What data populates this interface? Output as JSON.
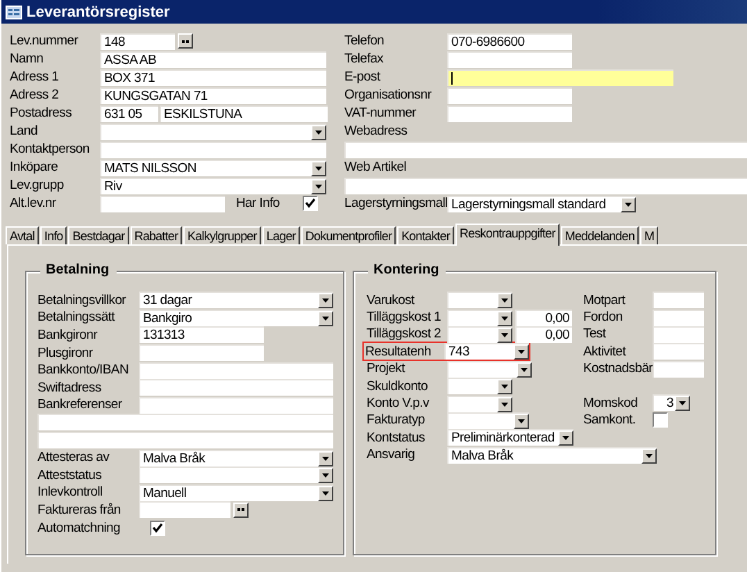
{
  "window": {
    "title": "Leverantörsregister"
  },
  "header_left": [
    {
      "label": "Lev.nummer",
      "fields": [
        {
          "kind": "lookup",
          "value": "148"
        }
      ]
    },
    {
      "label": "Namn",
      "fields": [
        {
          "kind": "text",
          "value": "ASSA AB"
        }
      ]
    },
    {
      "label": "Adress 1",
      "fields": [
        {
          "kind": "text",
          "value": "BOX 371"
        }
      ]
    },
    {
      "label": "Adress 2",
      "fields": [
        {
          "kind": "text",
          "value": "KUNGSGATAN 71"
        }
      ]
    },
    {
      "label": "Postadress",
      "fields": [
        {
          "kind": "zip",
          "value": "631 05"
        },
        {
          "kind": "city",
          "value": "ESKILSTUNA"
        }
      ]
    },
    {
      "label": "Land",
      "fields": [
        {
          "kind": "combo"
        }
      ]
    },
    {
      "label": "Kontaktperson",
      "fields": [
        {
          "kind": "text"
        }
      ]
    },
    {
      "label": "Inköpare",
      "fields": [
        {
          "kind": "combo",
          "value": "MATS NILSSON"
        }
      ]
    },
    {
      "label": "Lev.grupp",
      "fields": [
        {
          "kind": "combo",
          "value": "Riv"
        }
      ]
    },
    {
      "label": "Alt.lev.nr",
      "fields": [
        {
          "kind": "short"
        },
        {
          "kind": "check",
          "label": "Har Info",
          "checked": true
        }
      ]
    }
  ],
  "header_right": [
    {
      "label": "Telefon",
      "kind": "text",
      "value": "070-6986600",
      "focused": false
    },
    {
      "label": "Telefax",
      "kind": "text",
      "focused": false
    },
    {
      "label": "E-post",
      "kind": "text",
      "focused": true
    },
    {
      "label": "Organisationsnr",
      "kind": "text",
      "focused": false
    },
    {
      "label": "VAT-nummer",
      "kind": "text",
      "focused": false
    },
    {
      "label": "Webadress",
      "kind": "stacked"
    },
    {
      "label": "Web Artikel",
      "kind": "stacked"
    },
    {
      "label": "Lagerstyrningsmall",
      "kind": "combo",
      "value": "Lagerstyrningsmall standard"
    }
  ],
  "tabs": [
    {
      "label": "Avtal",
      "selected": false
    },
    {
      "label": "Info",
      "selected": false
    },
    {
      "label": "Bestdagar",
      "selected": false
    },
    {
      "label": "Rabatter",
      "selected": false
    },
    {
      "label": "Kalkylgrupper",
      "selected": false
    },
    {
      "label": "Lager",
      "selected": false
    },
    {
      "label": "Dokumentprofiler",
      "selected": false
    },
    {
      "label": "Kontakter",
      "selected": false
    },
    {
      "label": "Reskontrauppgifter",
      "selected": true
    },
    {
      "label": "Meddelanden",
      "selected": false
    },
    {
      "label": "M",
      "selected": false
    }
  ],
  "betalning": {
    "title": "Betalning",
    "rows": [
      {
        "label": "Betalningsvillkor",
        "kind": "combo",
        "value": "31 dagar"
      },
      {
        "label": "Betalningssätt",
        "kind": "combo",
        "value": "Bankgiro"
      },
      {
        "label": "Bankgironr",
        "kind": "short",
        "value": "131313"
      },
      {
        "label": "Plusgironr",
        "kind": "short"
      },
      {
        "label": "Bankkonto/IBAN",
        "kind": "text"
      },
      {
        "label": "Swiftadress",
        "kind": "text"
      },
      {
        "label": "Bankreferenser",
        "kind": "text"
      },
      {
        "kind": "wide"
      },
      {
        "kind": "wide"
      },
      {
        "label": "Attesteras av",
        "kind": "combo",
        "value": "Malva Bråk"
      },
      {
        "label": "Atteststatus",
        "kind": "combo"
      },
      {
        "label": "Inlevkontroll",
        "kind": "combo",
        "value": "Manuell"
      },
      {
        "label": "Faktureras från",
        "kind": "lookup"
      },
      {
        "label": "Automatchning",
        "kind": "check",
        "checked": true
      }
    ]
  },
  "kontering": {
    "title": "Kontering",
    "rows": [
      {
        "label": "Varukost",
        "kind": "combo",
        "highlighted": false
      },
      {
        "label": "Tilläggskost 1",
        "kind": "combo",
        "amount": "0,00",
        "highlighted": false
      },
      {
        "label": "Tilläggskost 2",
        "kind": "combo",
        "amount": "0,00",
        "highlighted": false
      },
      {
        "label": "Resultatenh",
        "kind": "combo",
        "value": "743",
        "highlighted": true
      },
      {
        "label": "Projekt",
        "kind": "combo",
        "highlighted": false
      },
      {
        "label": "Skuldkonto",
        "kind": "combo",
        "highlighted": false
      },
      {
        "label": "Konto V.p.v",
        "kind": "combo",
        "highlighted": false
      },
      {
        "label": "Fakturatyp",
        "kind": "combo",
        "highlighted": false
      },
      {
        "label": "Kontstatus",
        "kind": "combo",
        "value": "Preliminärkonterad",
        "highlighted": false
      },
      {
        "label": "Ansvarig",
        "kind": "combo",
        "value": "Malva Bråk",
        "highlighted": false
      }
    ],
    "side": [
      {
        "label": "Motpart",
        "kind": "text"
      },
      {
        "label": "Fordon",
        "kind": "text"
      },
      {
        "label": "Test",
        "kind": "text"
      },
      {
        "label": "Aktivitet",
        "kind": "text"
      },
      {
        "label": "Kostnadsbär",
        "kind": "text"
      },
      {
        "label": "Momskod",
        "kind": "combo",
        "value": "3"
      },
      {
        "label": "Samkont.",
        "kind": "check",
        "checked": false
      }
    ]
  }
}
